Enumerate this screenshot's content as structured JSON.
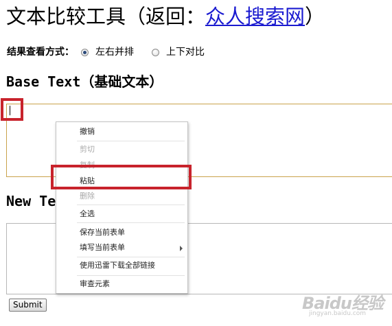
{
  "page": {
    "title_prefix": "文本比较工具（返回：",
    "title_link": "众人搜索网",
    "title_suffix": "）"
  },
  "view_mode": {
    "label": "结果查看方式：",
    "options": [
      {
        "label": "左右并排",
        "checked": true
      },
      {
        "label": "上下对比",
        "checked": false
      }
    ]
  },
  "base_section": {
    "heading": "Base Text（基础文本）",
    "value": ""
  },
  "new_section": {
    "heading": "New Te",
    "value": ""
  },
  "submit": {
    "label": "Submit"
  },
  "context_menu": {
    "items": [
      {
        "label": "撤销",
        "disabled": false
      },
      {
        "label": "剪切",
        "disabled": true
      },
      {
        "label": "复制",
        "disabled": true
      },
      {
        "label": "粘贴",
        "disabled": false
      },
      {
        "label": "删除",
        "disabled": true
      },
      {
        "label": "全选",
        "disabled": false
      },
      {
        "label": "保存当前表单",
        "disabled": false
      },
      {
        "label": "填写当前表单",
        "disabled": false,
        "has_submenu": true
      },
      {
        "label": "使用迅雷下载全部链接",
        "disabled": false
      },
      {
        "label": "审查元素",
        "disabled": false
      }
    ]
  },
  "watermark": {
    "logo": "Baidu经验",
    "sub": "jingyan.baidu.com"
  },
  "colors": {
    "link": "#1a1ad0",
    "highlight_box": "#c8232c",
    "focused_border": "#c9a24a",
    "disabled_text": "#a9a9a9"
  }
}
